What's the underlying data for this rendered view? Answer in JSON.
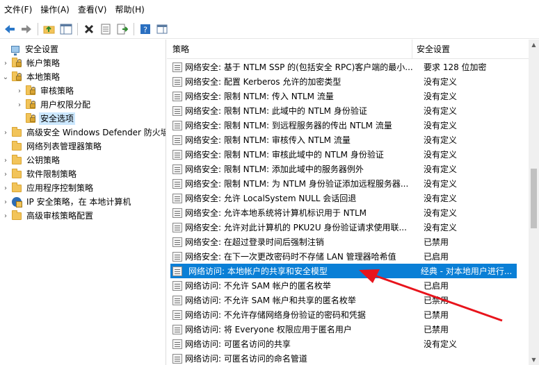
{
  "menubar": {
    "items": [
      {
        "label": "文件(F)"
      },
      {
        "label": "操作(A)"
      },
      {
        "label": "查看(V)"
      },
      {
        "label": "帮助(H)"
      }
    ]
  },
  "toolbar": {
    "buttons": [
      "back-icon",
      "forward-icon",
      "up-folder-icon",
      "show-tree-icon",
      "delete-icon",
      "properties-icon",
      "export-icon",
      "help-icon",
      "panel-icon"
    ]
  },
  "tree": {
    "items": [
      {
        "label": "安全设置",
        "arrow": "",
        "icon": "computer"
      },
      {
        "label": "帐户策略",
        "arrow": "›",
        "icon": "folder"
      },
      {
        "label": "本地策略",
        "arrow": "⌄",
        "icon": "folder"
      },
      {
        "label": "审核策略",
        "arrow": "›",
        "icon": "folder"
      },
      {
        "label": "用户权限分配",
        "arrow": "›",
        "icon": "folder"
      },
      {
        "label": "安全选项",
        "arrow": "",
        "icon": "folder",
        "selected": true
      },
      {
        "label": "高级安全 Windows Defender 防火墙",
        "arrow": "›",
        "icon": "folder"
      },
      {
        "label": "网络列表管理器策略",
        "arrow": "",
        "icon": "folder"
      },
      {
        "label": "公钥策略",
        "arrow": "›",
        "icon": "folder"
      },
      {
        "label": "软件限制策略",
        "arrow": "›",
        "icon": "folder"
      },
      {
        "label": "应用程序控制策略",
        "arrow": "›",
        "icon": "folder"
      },
      {
        "label": "IP 安全策略，在 本地计算机",
        "arrow": "›",
        "icon": "ipsec"
      },
      {
        "label": "高级审核策略配置",
        "arrow": "›",
        "icon": "folder"
      }
    ]
  },
  "list": {
    "headers": {
      "policy": "策略",
      "setting": "安全设置"
    },
    "rows": [
      {
        "policy": "网络安全: 基于 NTLM SSP 的(包括安全 RPC)客户端的最小...",
        "setting": "要求 128 位加密"
      },
      {
        "policy": "网络安全: 配置 Kerberos 允许的加密类型",
        "setting": "没有定义"
      },
      {
        "policy": "网络安全: 限制 NTLM: 传入 NTLM 流量",
        "setting": "没有定义"
      },
      {
        "policy": "网络安全: 限制 NTLM: 此域中的 NTLM 身份验证",
        "setting": "没有定义"
      },
      {
        "policy": "网络安全: 限制 NTLM: 到远程服务器的传出 NTLM 流量",
        "setting": "没有定义"
      },
      {
        "policy": "网络安全: 限制 NTLM: 审核传入 NTLM 流量",
        "setting": "没有定义"
      },
      {
        "policy": "网络安全: 限制 NTLM: 审核此域中的 NTLM 身份验证",
        "setting": "没有定义"
      },
      {
        "policy": "网络安全: 限制 NTLM: 添加此域中的服务器例外",
        "setting": "没有定义"
      },
      {
        "policy": "网络安全: 限制 NTLM: 为 NTLM 身份验证添加远程服务器...",
        "setting": "没有定义"
      },
      {
        "policy": "网络安全: 允许 LocalSystem NULL 会话回退",
        "setting": "没有定义"
      },
      {
        "policy": "网络安全: 允许本地系统将计算机标识用于 NTLM",
        "setting": "没有定义"
      },
      {
        "policy": "网络安全: 允许对此计算机的 PKU2U 身份验证请求使用联...",
        "setting": "没有定义"
      },
      {
        "policy": "网络安全: 在超过登录时间后强制注销",
        "setting": "已禁用"
      },
      {
        "policy": "网络安全: 在下一次更改密码时不存储 LAN 管理器哈希值",
        "setting": "已启用"
      },
      {
        "policy": "网络访问: 本地帐户的共享和安全模型",
        "setting": "经典 - 对本地用户进行...",
        "selected": true
      },
      {
        "policy": "网络访问: 不允许 SAM 帐户的匿名枚举",
        "setting": "已启用"
      },
      {
        "policy": "网络访问: 不允许 SAM 帐户和共享的匿名枚举",
        "setting": "已禁用"
      },
      {
        "policy": "网络访问: 不允许存储网络身份验证的密码和凭据",
        "setting": "已禁用"
      },
      {
        "policy": "网络访问: 将 Everyone 权限应用于匿名用户",
        "setting": "已禁用"
      },
      {
        "policy": "网络访问: 可匿名访问的共享",
        "setting": "没有定义"
      },
      {
        "policy": "网络访问: 可匿名访问的命名管道",
        "setting": ""
      }
    ]
  },
  "colors": {
    "selection": "#0a7fd6",
    "tree_selection": "#cce8ff",
    "annotation_arrow": "#e8141c"
  }
}
